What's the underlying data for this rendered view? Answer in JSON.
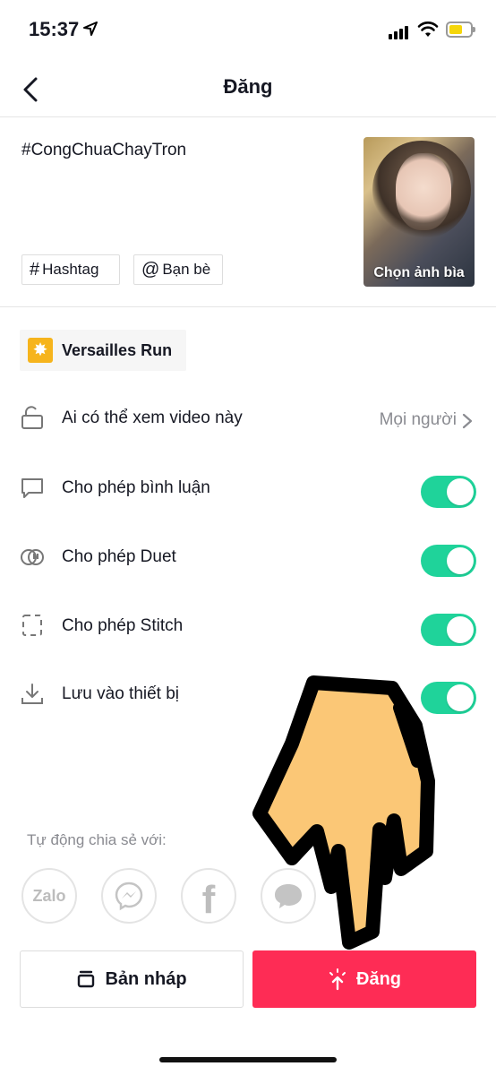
{
  "status_bar": {
    "time": "15:37"
  },
  "nav": {
    "title": "Đăng"
  },
  "caption": "#CongChuaChayTron",
  "chips": {
    "hashtag": "Hashtag",
    "friends": "Bạn bè"
  },
  "cover": {
    "label": "Chọn ảnh bìa"
  },
  "effect": {
    "label": "Versailles Run"
  },
  "settings": {
    "privacy": {
      "label": "Ai có thể xem video này",
      "value": "Mọi người"
    },
    "comments": {
      "label": "Cho phép bình luận",
      "enabled": true
    },
    "duet": {
      "label": "Cho phép Duet",
      "enabled": true
    },
    "stitch": {
      "label": "Cho phép Stitch",
      "enabled": true
    },
    "save": {
      "label": "Lưu vào thiết bị",
      "enabled": true
    }
  },
  "share": {
    "label": "Tự động chia sẻ với:",
    "zalo": "Zalo"
  },
  "buttons": {
    "draft": "Bản nháp",
    "post": "Đăng"
  },
  "colors": {
    "accent": "#fe2c55",
    "toggle_on": "#1fd39a",
    "effect_icon": "#f6b41c"
  }
}
